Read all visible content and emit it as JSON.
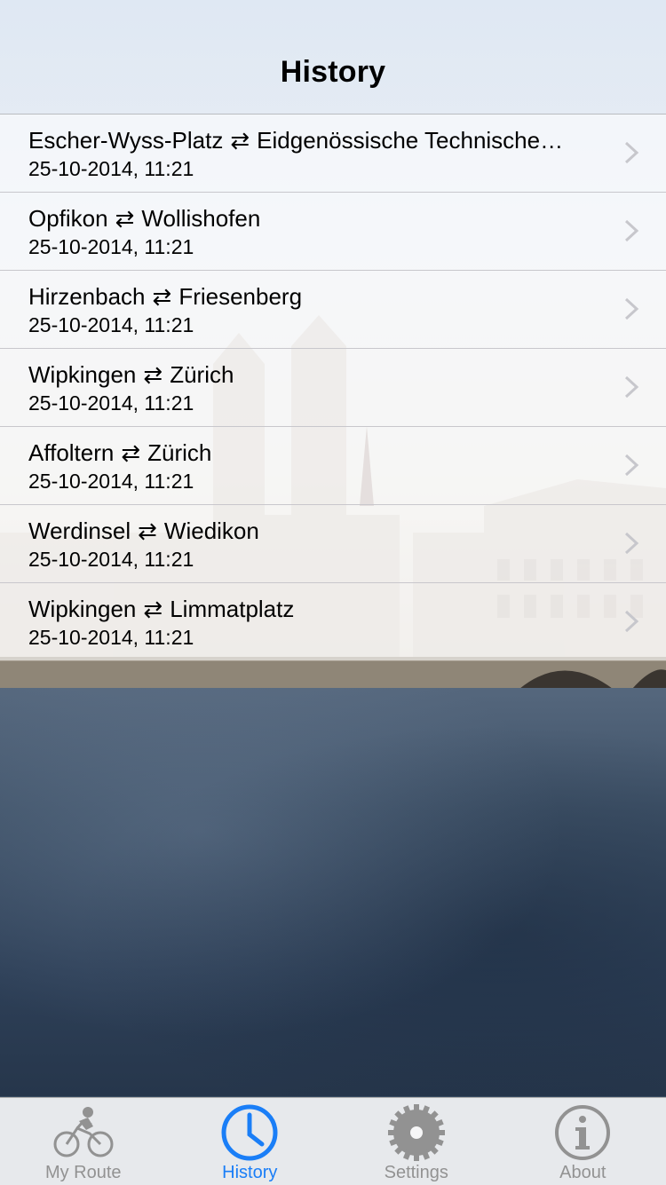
{
  "header": {
    "title": "History"
  },
  "history": [
    {
      "from": "Escher-Wyss-Platz",
      "arrow": "⇄",
      "to": "Eidgenössische Technische…",
      "date": "25-10-2014, 11:21"
    },
    {
      "from": "Opfikon",
      "arrow": "⇄",
      "to": "Wollishofen",
      "date": "25-10-2014, 11:21"
    },
    {
      "from": "Hirzenbach",
      "arrow": "⇄",
      "to": "Friesenberg",
      "date": "25-10-2014, 11:21"
    },
    {
      "from": "Wipkingen",
      "arrow": "⇄",
      "to": "Zürich",
      "date": "25-10-2014, 11:21"
    },
    {
      "from": "Affoltern",
      "arrow": "⇄",
      "to": "Zürich",
      "date": "25-10-2014, 11:21"
    },
    {
      "from": "Werdinsel",
      "arrow": "⇄",
      "to": "Wiedikon",
      "date": "25-10-2014, 11:21"
    },
    {
      "from": "Wipkingen",
      "arrow": "⇄",
      "to": "Limmatplatz",
      "date": "25-10-2014, 11:21"
    }
  ],
  "tabbar": {
    "tabs": [
      {
        "label": "My Route",
        "icon": "bicycle-icon",
        "active": false
      },
      {
        "label": "History",
        "icon": "clock-icon",
        "active": true
      },
      {
        "label": "Settings",
        "icon": "gear-icon",
        "active": false
      },
      {
        "label": "About",
        "icon": "info-icon",
        "active": false
      }
    ]
  },
  "colors": {
    "accent": "#1a7ef7",
    "inactive_tab": "#929292"
  }
}
